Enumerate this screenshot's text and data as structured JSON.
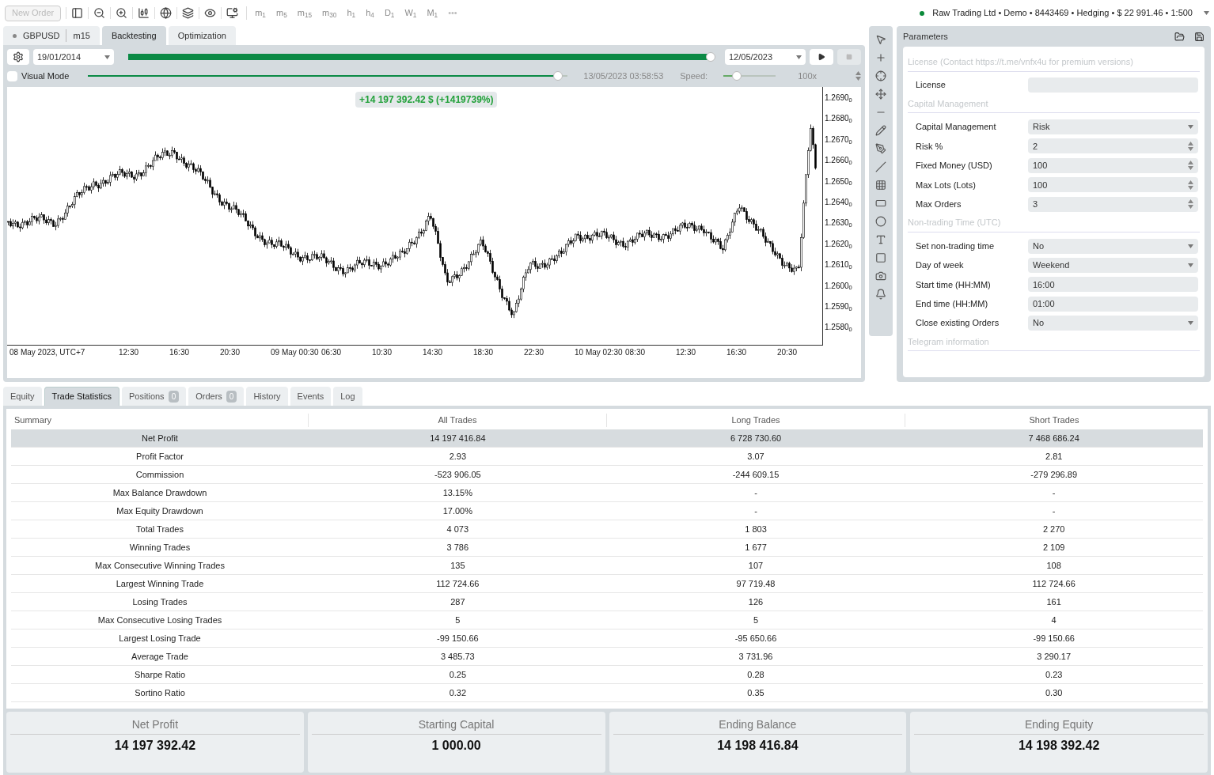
{
  "toolbar": {
    "new_order": {
      "label": "New Order",
      "disabled": true
    },
    "timeframes": [
      {
        "label": "m$_{1}$",
        "disabled": true
      },
      {
        "label": "m$_{5}$",
        "disabled": true
      },
      {
        "label": "m$_{15}$",
        "disabled": true
      },
      {
        "label": "m$_{30}$",
        "disabled": true
      },
      {
        "label": "h$_{1}$",
        "disabled": true
      },
      {
        "label": "h$_{4}$",
        "disabled": true
      },
      {
        "label": "D$_{1}$",
        "disabled": true
      },
      {
        "label": "W$_{1}$",
        "disabled": true
      },
      {
        "label": "M$_{1}$",
        "disabled": true
      }
    ],
    "more": "•••",
    "account": {
      "text": "Raw Trading Ltd • Demo • 8443469 • Hedging • $ 22 991.46 • 1:500",
      "connected": true
    }
  },
  "chart_tabs": [
    {
      "kind": "symbol",
      "symbol": "GBPUSD",
      "timeframe": "m15",
      "selected": false
    },
    {
      "kind": "plain",
      "label": "Backtesting",
      "selected": true
    },
    {
      "kind": "plain",
      "label": "Optimization",
      "selected": false
    }
  ],
  "backtest": {
    "start_date": "19/01/2014",
    "end_date": "12/05/2023",
    "progress": {
      "level": 1
    },
    "visual_mode": {
      "label": "Visual Mode",
      "checked": false
    },
    "timeline": {
      "level": 0.98
    },
    "timestamp": "13/05/2023 03:58:53",
    "speed": {
      "label": "Speed:",
      "level": 0.25,
      "value": "100x"
    }
  },
  "chart": {
    "profit_badge": "+14 197 392.42 $ (+1419739%)",
    "y_ticks": [
      "1.2690$_{0}$",
      "1.2680$_{0}$",
      "1.2670$_{0}$",
      "1.2660$_{0}$",
      "1.2650$_{0}$",
      "1.2640$_{0}$",
      "1.2630$_{0}$",
      "1.2620$_{0}$",
      "1.2610$_{0}$",
      "1.2600$_{0}$",
      "1.2590$_{0}$",
      "1.2580$_{0}$"
    ],
    "x_ticks": [
      "08 May 2023, UTC+7",
      "12:30",
      "16:30",
      "20:30",
      "09 May 00:30",
      "06:30",
      "10:30",
      "14:30",
      "18:30",
      "22:30",
      "10 May 02:30",
      "08:30",
      "12:30",
      "16:30",
      "20:30"
    ]
  },
  "parameters": {
    "title": "Parameters",
    "groups": [
      {
        "title": "License (Contact https://t.me/vnfx4u for premium versions)",
        "params": [
          {
            "label": "License",
            "kind": "text"
          }
        ]
      },
      {
        "title": "Capital Management",
        "params": [
          {
            "label": "Capital Management",
            "kind": "select",
            "value": "Risk"
          },
          {
            "label": "Risk %",
            "kind": "number",
            "value": "2"
          },
          {
            "label": "Fixed Money (USD)",
            "kind": "number",
            "value": "100"
          },
          {
            "label": "Max Lots (Lots)",
            "kind": "number",
            "value": "100"
          },
          {
            "label": "Max Orders",
            "kind": "number",
            "value": "3"
          }
        ]
      },
      {
        "title": "Non-trading Time (UTC)",
        "params": [
          {
            "label": "Set non-trading time",
            "kind": "select",
            "value": "No"
          },
          {
            "label": "Day of week",
            "kind": "select",
            "value": "Weekend"
          },
          {
            "label": "Start time (HH:MM)",
            "kind": "text",
            "value": "16:00"
          },
          {
            "label": "End time (HH:MM)",
            "kind": "text",
            "value": "01:00"
          },
          {
            "label": "Close existing Orders",
            "kind": "select",
            "value": "No"
          }
        ]
      },
      {
        "title": "Telegram information"
      }
    ]
  },
  "bottom_tabs": [
    {
      "label": "Equity",
      "selected": false
    },
    {
      "label": "Trade Statistics",
      "selected": true
    },
    {
      "label": "Positions",
      "count": "0",
      "selected": false
    },
    {
      "label": "Orders",
      "count": "0",
      "selected": false
    },
    {
      "label": "History",
      "selected": false
    },
    {
      "label": "Events",
      "selected": false
    },
    {
      "label": "Log",
      "selected": false
    }
  ],
  "statistics": {
    "columns": [
      "Summary",
      "All Trades",
      "Long Trades",
      "Short Trades"
    ],
    "rows": [
      {
        "cells": [
          "Net Profit",
          "14 197 416.84",
          "6 728 730.60",
          "7 468 686.24"
        ],
        "selected": true
      },
      {
        "cells": [
          "Profit Factor",
          "2.93",
          "3.07",
          "2.81"
        ],
        "selected": false
      },
      {
        "cells": [
          "Commission",
          "-523 906.05",
          "-244 609.15",
          "-279 296.89"
        ],
        "selected": false
      },
      {
        "cells": [
          "Max Balance Drawdown",
          "13.15%",
          "-",
          "-"
        ],
        "selected": false
      },
      {
        "cells": [
          "Max Equity Drawdown",
          "17.00%",
          "-",
          "-"
        ],
        "selected": false
      },
      {
        "cells": [
          "Total Trades",
          "4 073",
          "1 803",
          "2 270"
        ],
        "selected": false
      },
      {
        "cells": [
          "Winning Trades",
          "3 786",
          "1 677",
          "2 109"
        ],
        "selected": false
      },
      {
        "cells": [
          "Max Consecutive Winning Trades",
          "135",
          "107",
          "108"
        ],
        "selected": false
      },
      {
        "cells": [
          "Largest Winning Trade",
          "112 724.66",
          "97 719.48",
          "112 724.66"
        ],
        "selected": false
      },
      {
        "cells": [
          "Losing Trades",
          "287",
          "126",
          "161"
        ],
        "selected": false
      },
      {
        "cells": [
          "Max Consecutive Losing Trades",
          "5",
          "5",
          "4"
        ],
        "selected": false
      },
      {
        "cells": [
          "Largest Losing Trade",
          "-99 150.66",
          "-95 650.66",
          "-99 150.66"
        ],
        "selected": false
      },
      {
        "cells": [
          "Average Trade",
          "3 485.73",
          "3 731.96",
          "3 290.17"
        ],
        "selected": false
      },
      {
        "cells": [
          "Sharpe Ratio",
          "0.25",
          "0.28",
          "0.23"
        ],
        "selected": false
      },
      {
        "cells": [
          "Sortino Ratio",
          "0.32",
          "0.35",
          "0.30"
        ],
        "selected": false
      }
    ]
  },
  "summary_cards": [
    {
      "label": "Net Profit",
      "value": "14 197 392.42"
    },
    {
      "label": "Starting Capital",
      "value": "1 000.00"
    },
    {
      "label": "Ending Balance",
      "value": "14 198 416.84"
    },
    {
      "label": "Ending Equity",
      "value": "14 198 392.42"
    }
  ]
}
